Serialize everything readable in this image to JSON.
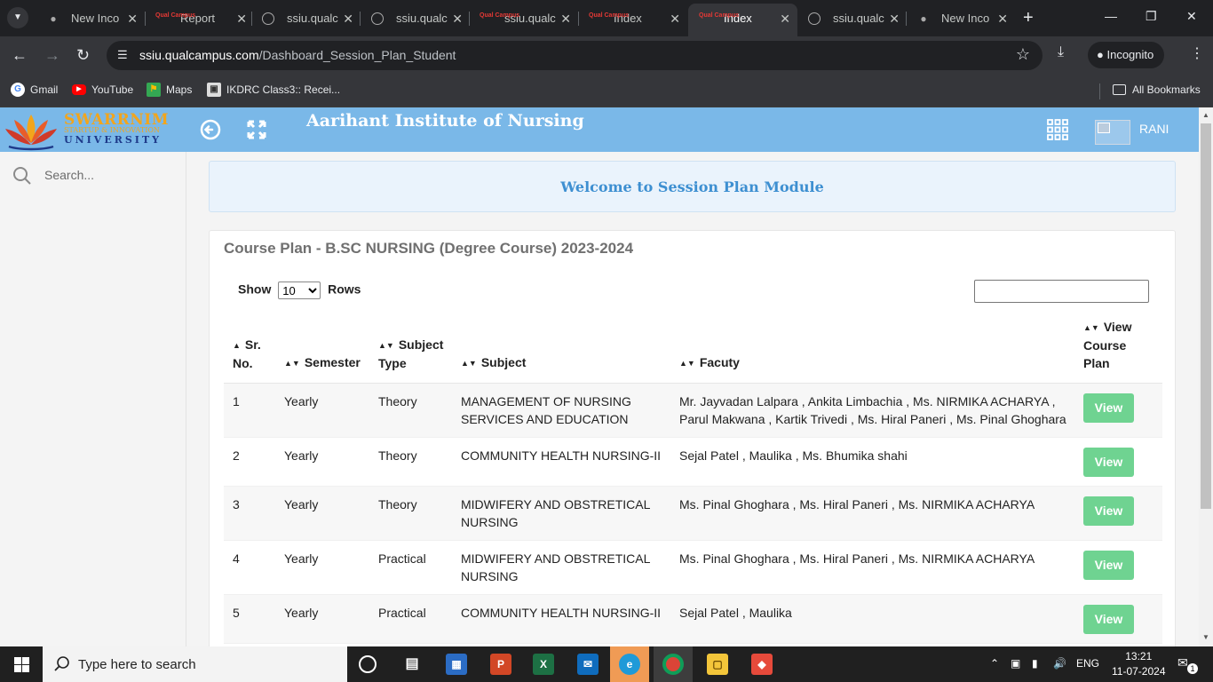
{
  "browser": {
    "tabs": [
      {
        "title": "New Inco",
        "icon": "incognito-icon"
      },
      {
        "title": "Report",
        "icon": "qualcampus-icon"
      },
      {
        "title": "ssiu.qualc",
        "icon": "globe-icon"
      },
      {
        "title": "ssiu.qualc",
        "icon": "globe-icon"
      },
      {
        "title": "ssiu.qualc",
        "icon": "qualcampus-icon"
      },
      {
        "title": "Index",
        "icon": "qualcampus-icon"
      },
      {
        "title": "Index",
        "icon": "qualcampus-icon",
        "active": true
      },
      {
        "title": "ssiu.qualc",
        "icon": "globe-icon"
      },
      {
        "title": "New Inco",
        "icon": "incognito-icon"
      }
    ],
    "favicon_text": "Qual Campus",
    "url_domain": "ssiu.qualcampus.com",
    "url_path": "/Dashboard_Session_Plan_Student",
    "profile_label": "Incognito",
    "bookmarks": [
      {
        "label": "Gmail",
        "icon": "google-icon"
      },
      {
        "label": "YouTube",
        "icon": "youtube-icon"
      },
      {
        "label": "Maps",
        "icon": "maps-icon"
      },
      {
        "label": "IKDRC Class3:: Recei...",
        "icon": "ikdrc-icon"
      }
    ],
    "all_bookmarks_label": "All Bookmarks"
  },
  "header": {
    "logo_line1": "SWARRNIM",
    "logo_line2": "STARTUP & INNOVATION",
    "logo_line3": "UNIVERSITY",
    "institute_name": "Aarihant Institute of Nursing",
    "user_name": "RANI"
  },
  "sidebar": {
    "search_placeholder": "Search..."
  },
  "main": {
    "welcome_text": "Welcome to Session Plan Module",
    "card_title": "Course Plan - B.SC NURSING (Degree Course) 2023-2024",
    "show_label": "Show",
    "rows_label": "Rows",
    "page_size": "10",
    "columns": {
      "sr_no": "Sr. No.",
      "semester": "Semester",
      "subject_type": "Subject Type",
      "subject": "Subject",
      "faculty": "Facuty",
      "view": "View Course Plan"
    },
    "view_label": "View",
    "rows": [
      {
        "sr": "1",
        "semester": "Yearly",
        "type": "Theory",
        "subject": "MANAGEMENT OF NURSING SERVICES AND EDUCATION",
        "faculty": "Mr. Jayvadan Lalpara , Ankita Limbachia , Ms. NIRMIKA ACHARYA , Parul Makwana , Kartik Trivedi , Ms. Hiral Paneri , Ms. Pinal Ghoghara"
      },
      {
        "sr": "2",
        "semester": "Yearly",
        "type": "Theory",
        "subject": "COMMUNITY HEALTH NURSING-II",
        "faculty": "Sejal Patel , Maulika , Ms. Bhumika shahi"
      },
      {
        "sr": "3",
        "semester": "Yearly",
        "type": "Theory",
        "subject": "MIDWIFERY AND OBSTRETICAL NURSING",
        "faculty": "Ms. Pinal Ghoghara , Ms. Hiral Paneri , Ms. NIRMIKA ACHARYA"
      },
      {
        "sr": "4",
        "semester": "Yearly",
        "type": "Practical",
        "subject": "MIDWIFERY AND OBSTRETICAL NURSING",
        "faculty": "Ms. Pinal Ghoghara , Ms. Hiral Paneri , Ms. NIRMIKA ACHARYA"
      },
      {
        "sr": "5",
        "semester": "Yearly",
        "type": "Practical",
        "subject": "COMMUNITY HEALTH NURSING-II",
        "faculty": "Sejal Patel , Maulika"
      }
    ]
  },
  "taskbar": {
    "search_placeholder": "Type here to search",
    "language": "ENG",
    "time": "13:21",
    "date": "11-07-2024",
    "notification_count": "1"
  },
  "colors": {
    "header_bg": "#7ab8e8",
    "accent_blue": "#3d8fd1",
    "view_button": "#6fd391"
  }
}
